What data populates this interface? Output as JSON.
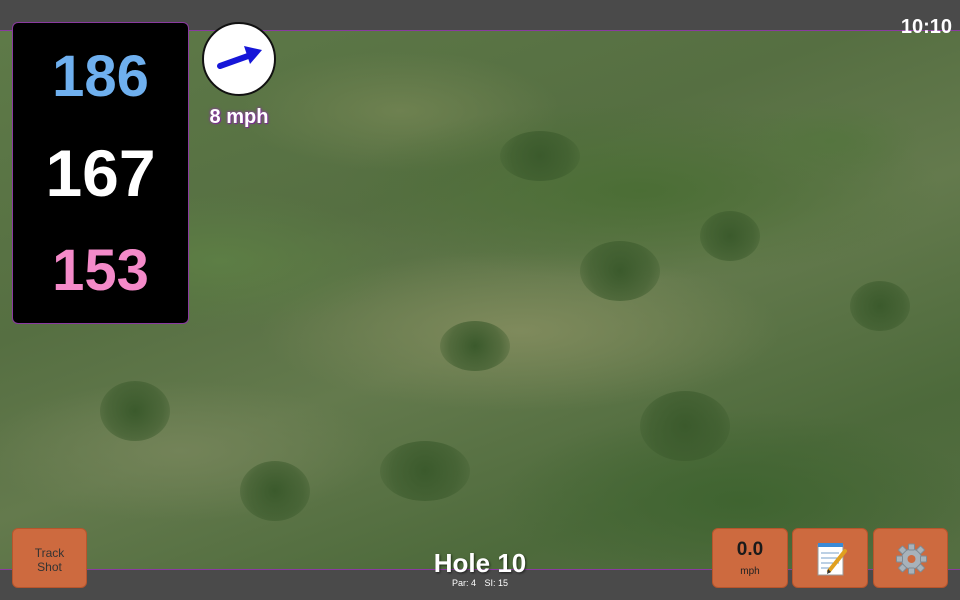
{
  "status": {
    "time": "10:10"
  },
  "distances": {
    "back": "186",
    "middle": "167",
    "front": "153"
  },
  "wind": {
    "speed": "8 mph",
    "direction_icon": "arrow-icon"
  },
  "hole": {
    "title": "Hole 10",
    "par": "Par: 4",
    "si": "SI: 15"
  },
  "buttons": {
    "track_shot_line1": "Track",
    "track_shot_line2": "Shot",
    "speed_value": "0.0",
    "speed_unit": "mph",
    "notes_icon": "notepad-icon",
    "settings_icon": "gear-icon"
  },
  "colors": {
    "back_distance": "#6fb0ef",
    "middle_distance": "#ffffff",
    "front_distance": "#f48ac9",
    "button": "#cd6a3f",
    "accent": "#8a3aa0"
  }
}
